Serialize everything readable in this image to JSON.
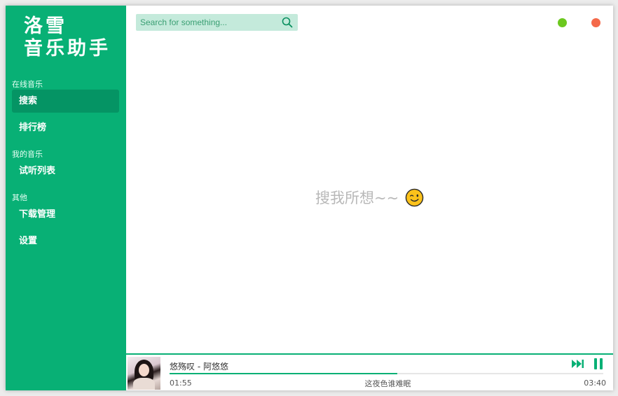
{
  "app": {
    "logo_line1": "洛雪",
    "logo_line2": "音乐助手"
  },
  "sidebar": {
    "sections": [
      {
        "title": "在线音乐"
      },
      {
        "title": "我的音乐"
      },
      {
        "title": "其他"
      }
    ],
    "items": [
      {
        "label": "搜索",
        "active": true
      },
      {
        "label": "排行榜"
      },
      {
        "label": "试听列表"
      },
      {
        "label": "下载管理"
      },
      {
        "label": "设置"
      }
    ]
  },
  "search": {
    "placeholder": "Search for something...",
    "value": ""
  },
  "main": {
    "empty_message": "搜我所想~~"
  },
  "player": {
    "title": "悠殇叹 - 阿悠悠",
    "current_time": "01:55",
    "total_time": "03:40",
    "lyric": "这夜色谁难眠",
    "progress": 0.525
  },
  "colors": {
    "accent": "#08b075",
    "accent_dark": "#059464",
    "minimize": "#6cc81f",
    "close": "#f4694a"
  },
  "icons": {
    "search": "search-icon",
    "wink": "wink-emoji-icon",
    "next": "next-track-icon",
    "pause": "pause-icon"
  }
}
